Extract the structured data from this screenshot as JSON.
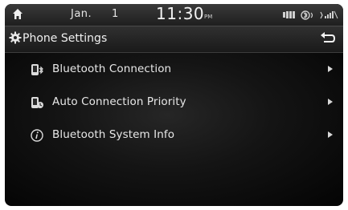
{
  "status": {
    "date": "Jan.",
    "day": "1",
    "time": "11:30",
    "ampm": "PM"
  },
  "header": {
    "title": "Phone Settings",
    "icon": "gear-icon",
    "back_icon": "back-arrow-icon"
  },
  "menu": {
    "items": [
      {
        "label": "Bluetooth Connection",
        "icon": "bluetooth-phone-icon"
      },
      {
        "label": "Auto Connection Priority",
        "icon": "auto-connection-icon"
      },
      {
        "label": "Bluetooth System Info",
        "icon": "info-icon"
      }
    ]
  },
  "colors": {
    "text": "#e8e8e8",
    "background": "#141414"
  }
}
